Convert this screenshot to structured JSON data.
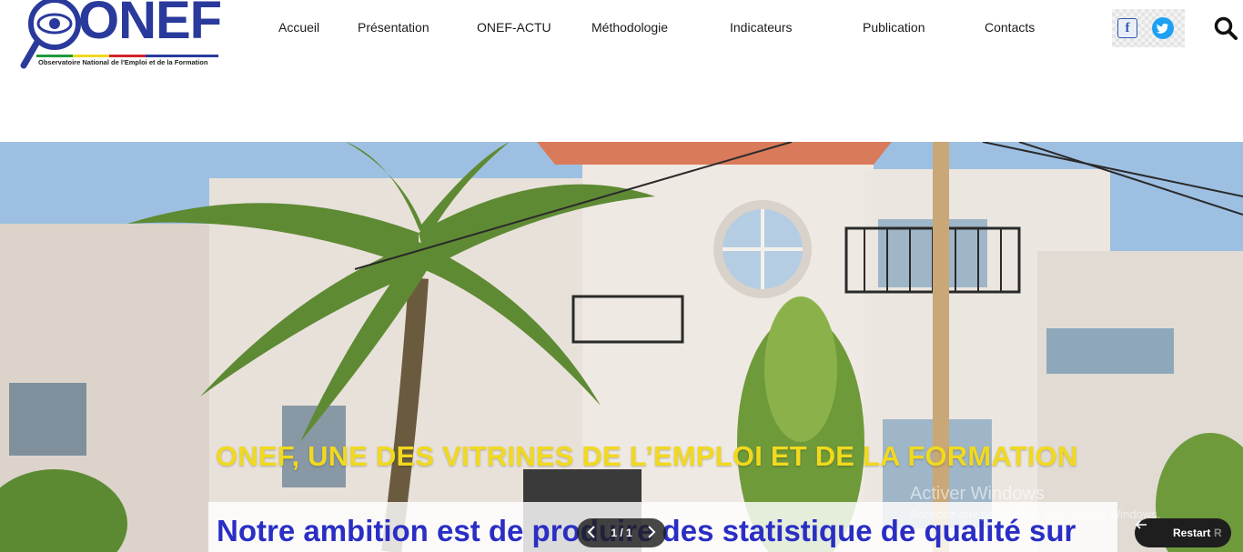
{
  "brand": {
    "logo_text": "ONEF",
    "tagline": "Observatoire National de l'Emploi et de la Formation",
    "colors": {
      "primary": "#2a3a9c",
      "flag_green": "#1e9a3a",
      "flag_yellow": "#f1d91f",
      "flag_red": "#d4232b"
    }
  },
  "nav": {
    "items": [
      {
        "label": "Accueil"
      },
      {
        "label": "Présentation"
      },
      {
        "label": "ONEF-ACTU"
      },
      {
        "label": "Méthodologie"
      },
      {
        "label": "Indicateurs"
      },
      {
        "label": "Publication"
      },
      {
        "label": "Contacts"
      }
    ]
  },
  "social": {
    "facebook_icon": "facebook-icon",
    "twitter_icon": "twitter-icon",
    "facebook_glyph": "f"
  },
  "search": {
    "icon": "search-icon"
  },
  "hero": {
    "title": "ONEF, UNE DES VITRINES DE L’EMPLOI ET DE LA FORMATION",
    "subtitle": "Notre ambition est de produire des statistique de qualité sur",
    "title_color": "#f1d91f",
    "subtitle_color": "#2a2ec4"
  },
  "slider": {
    "counter": "1 / 1",
    "prev_icon": "chevron-left-icon",
    "next_icon": "chevron-right-icon"
  },
  "system_overlay": {
    "watermark_title": "Activer Windows",
    "watermark_sub": "Accédez aux paramètres pour activer Windows."
  },
  "restart": {
    "label": "Restart",
    "shortcut": "R",
    "icon": "restart-arrow-icon"
  }
}
